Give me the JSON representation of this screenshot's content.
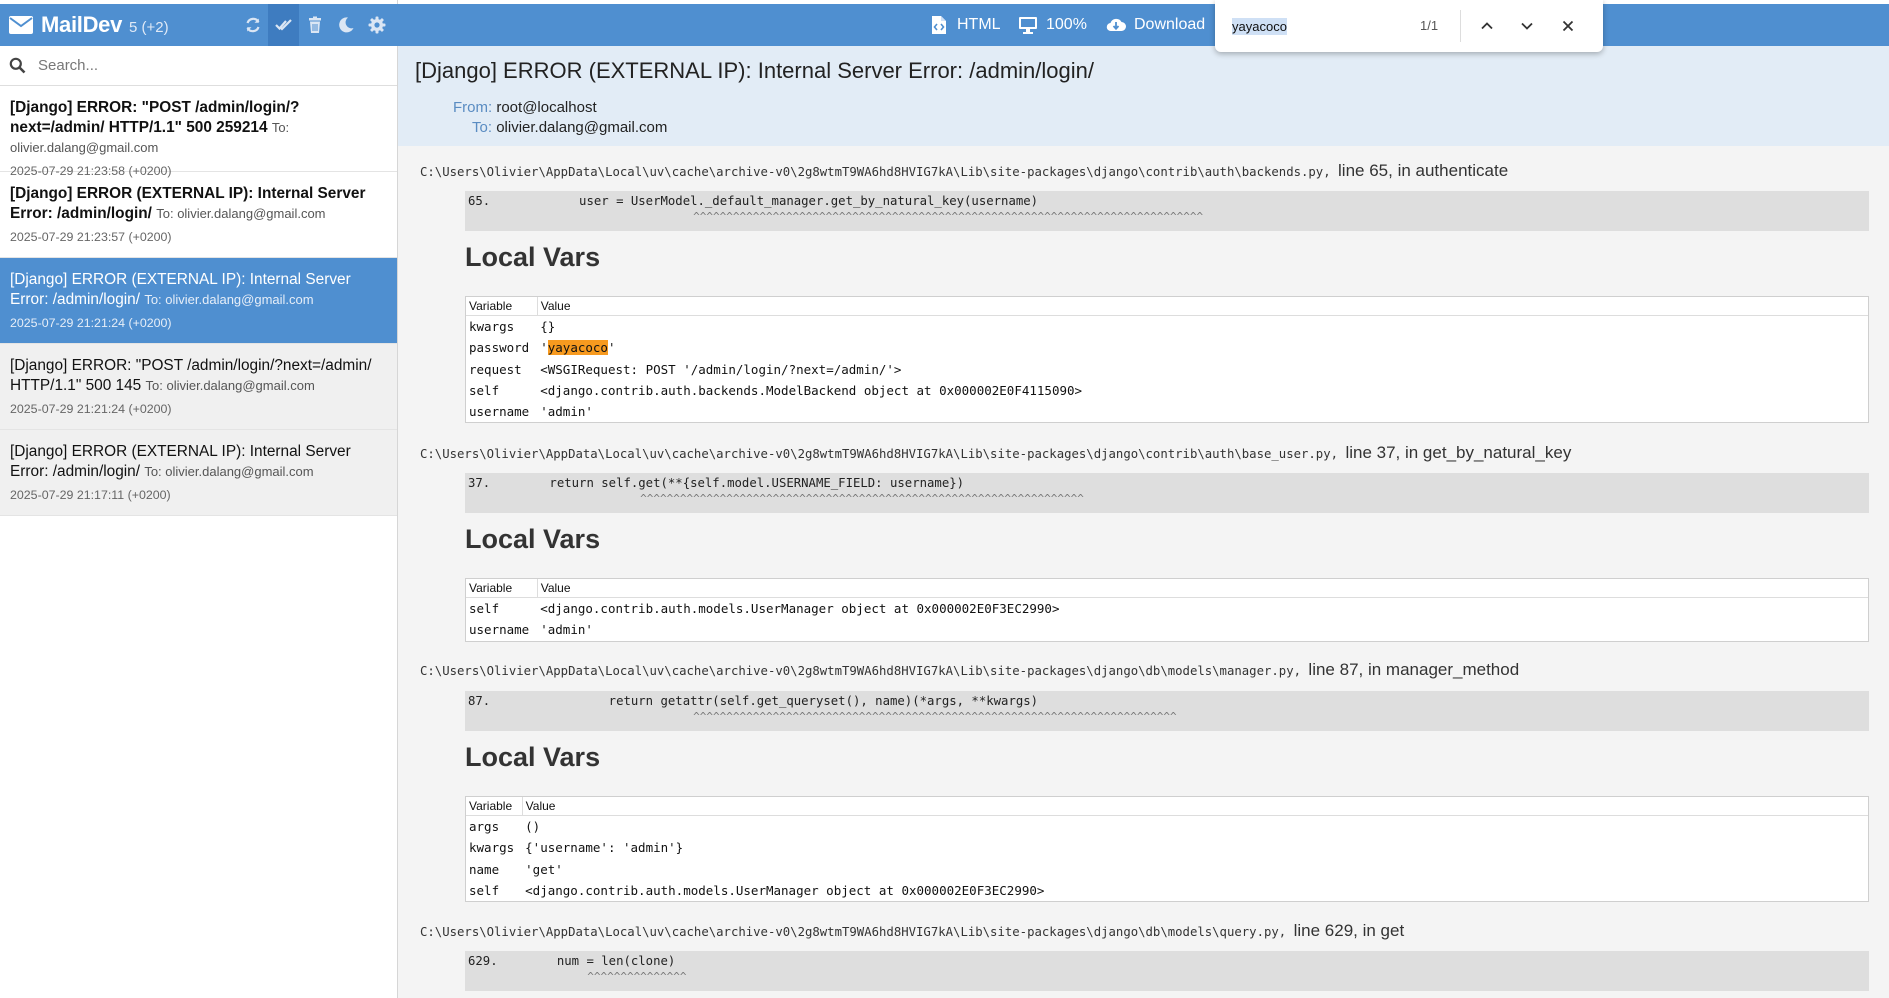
{
  "sidebar": {
    "brand": "MailDev",
    "count": "5 (+2)",
    "search_placeholder": "Search...",
    "emails": [
      {
        "subject": "[Django] ERROR: \"POST /admin/login/?next=/admin/ HTTP/1.1\" 500 259214",
        "to": "To: olivier.dalang@gmail.com",
        "date": "2025-07-29 21:23:58 (+0200)",
        "state": "unread"
      },
      {
        "subject": "[Django] ERROR (EXTERNAL IP): Internal Server Error: /admin/login/",
        "to": "To: olivier.dalang@gmail.com",
        "date": "2025-07-29 21:23:57 (+0200)",
        "state": "unread"
      },
      {
        "subject": "[Django] ERROR (EXTERNAL IP): Internal Server Error: /admin/login/",
        "to": "To: olivier.dalang@gmail.com",
        "date": "2025-07-29 21:21:24 (+0200)",
        "state": "selected"
      },
      {
        "subject": "[Django] ERROR: \"POST /admin/login/?next=/admin/ HTTP/1.1\" 500 145",
        "to": "To: olivier.dalang@gmail.com",
        "date": "2025-07-29 21:21:24 (+0200)",
        "state": "read"
      },
      {
        "subject": "[Django] ERROR (EXTERNAL IP): Internal Server Error: /admin/login/",
        "to": "To: olivier.dalang@gmail.com",
        "date": "2025-07-29 21:17:11 (+0200)",
        "state": "read"
      }
    ]
  },
  "toolbar": {
    "html_label": "HTML",
    "zoom_label": "100%",
    "download_label": "Download"
  },
  "find": {
    "query": "yayacoco",
    "count": "1/1"
  },
  "email": {
    "subject": "[Django] ERROR (EXTERNAL IP): Internal Server Error: /admin/login/",
    "from_label": "From:",
    "from": "root@localhost",
    "to_label": "To:",
    "to": "olivier.dalang@gmail.com"
  },
  "traceback": {
    "local_vars_title": "Local Vars",
    "var_header": "Variable",
    "value_header": "Value",
    "frames": [
      {
        "path": "C:\\Users\\Olivier\\AppData\\Local\\uv\\cache\\archive-v0\\2g8wtmT9WA6hd8HVIG7kA\\Lib\\site-packages\\django\\contrib\\auth\\backends.py",
        "lineinfo": "line 65, in authenticate",
        "code": "65.            user = UserModel._default_manager.get_by_natural_key(username)",
        "carets": "                                  ^^^^^^^^^^^^^^^^^^^^^^^^^^^^^^^^^^^^^^^^^^^^^^^^^^^^^^^^^^^^^^^^^^^^^^^^^^^^^",
        "vars": [
          {
            "name": "kwargs",
            "value": "{}"
          },
          {
            "name": "password",
            "value_pre": "'",
            "value_hl": "yayacoco",
            "value_post": "'"
          },
          {
            "name": "request",
            "value": "<WSGIRequest: POST '/admin/login/?next=/admin/'>"
          },
          {
            "name": "self",
            "value": "<django.contrib.auth.backends.ModelBackend object at 0x000002E0F4115090>"
          },
          {
            "name": "username",
            "value": "'admin'"
          }
        ]
      },
      {
        "path": "C:\\Users\\Olivier\\AppData\\Local\\uv\\cache\\archive-v0\\2g8wtmT9WA6hd8HVIG7kA\\Lib\\site-packages\\django\\contrib\\auth\\base_user.py",
        "lineinfo": "line 37, in get_by_natural_key",
        "code": "37.        return self.get(**{self.model.USERNAME_FIELD: username})",
        "carets": "                          ^^^^^^^^^^^^^^^^^^^^^^^^^^^^^^^^^^^^^^^^^^^^^^^^^^^^^^^^^^^^^^^^^^^",
        "vars": [
          {
            "name": "self",
            "value": "<django.contrib.auth.models.UserManager object at 0x000002E0F3EC2990>"
          },
          {
            "name": "username",
            "value": "'admin'"
          }
        ]
      },
      {
        "path": "C:\\Users\\Olivier\\AppData\\Local\\uv\\cache\\archive-v0\\2g8wtmT9WA6hd8HVIG7kA\\Lib\\site-packages\\django\\db\\models\\manager.py",
        "lineinfo": "line 87, in manager_method",
        "code": "87.                return getattr(self.get_queryset(), name)(*args, **kwargs)",
        "carets": "                                  ^^^^^^^^^^^^^^^^^^^^^^^^^^^^^^^^^^^^^^^^^^^^^^^^^^^^^^^^^^^^^^^^^^^^^^^^^",
        "vars": [
          {
            "name": "args",
            "value": "()"
          },
          {
            "name": "kwargs",
            "value": "{'username': 'admin'}"
          },
          {
            "name": "name",
            "value": "'get'"
          },
          {
            "name": "self",
            "value": "<django.contrib.auth.models.UserManager object at 0x000002E0F3EC2990>"
          }
        ]
      },
      {
        "path": "C:\\Users\\Olivier\\AppData\\Local\\uv\\cache\\archive-v0\\2g8wtmT9WA6hd8HVIG7kA\\Lib\\site-packages\\django\\db\\models\\query.py",
        "lineinfo": "line 629, in get",
        "code": "629.        num = len(clone)",
        "carets": "                  ^^^^^^^^^^^^^^^",
        "vars": []
      }
    ]
  },
  "colors": {
    "accent": "#4f8fd0",
    "header_bg": "#e2ecf6",
    "highlight": "#f79a1f"
  }
}
